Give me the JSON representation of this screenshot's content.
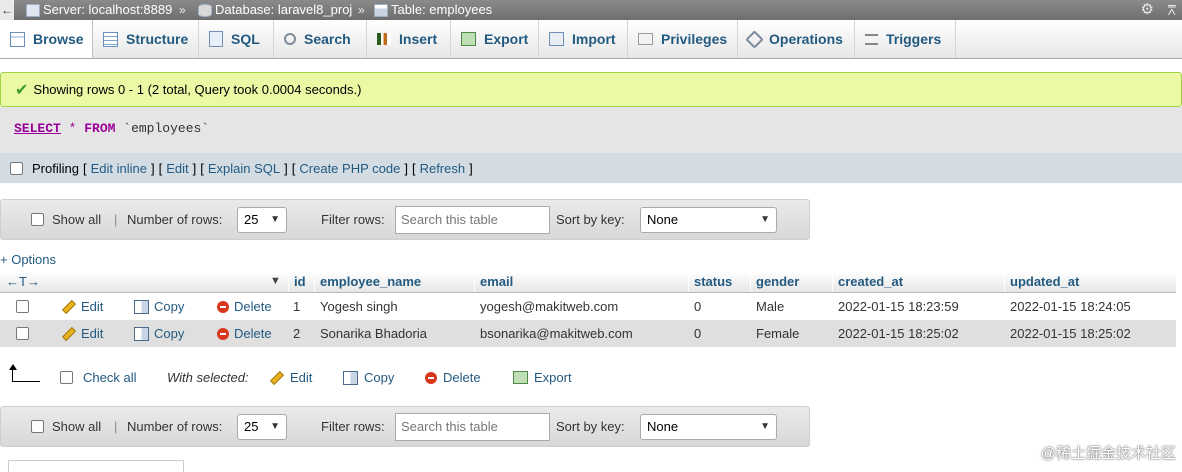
{
  "breadcrumb": {
    "back": "←",
    "server": "Server: localhost:8889",
    "database": "Database: laravel8_proj",
    "table": "Table: employees",
    "separator": "»"
  },
  "tabs": [
    {
      "label": "Browse",
      "icon": "browse-icon",
      "active": true
    },
    {
      "label": "Structure",
      "icon": "structure-icon"
    },
    {
      "label": "SQL",
      "icon": "sql-icon"
    },
    {
      "label": "Search",
      "icon": "search-icon"
    },
    {
      "label": "Insert",
      "icon": "insert-icon"
    },
    {
      "label": "Export",
      "icon": "export-icon"
    },
    {
      "label": "Import",
      "icon": "import-icon"
    },
    {
      "label": "Privileges",
      "icon": "privileges-icon"
    },
    {
      "label": "Operations",
      "icon": "operations-icon"
    },
    {
      "label": "Triggers",
      "icon": "triggers-icon"
    }
  ],
  "message": {
    "text": "Showing rows 0 - 1 (2 total, Query took 0.0004 seconds.)"
  },
  "sql": {
    "select": "SELECT",
    "star": "*",
    "from": "FROM",
    "table": "`employees`"
  },
  "profiling": {
    "label": "Profiling",
    "open": "[",
    "close": "]",
    "links": [
      "Edit inline",
      "Edit",
      "Explain SQL",
      "Create PHP code",
      "Refresh"
    ]
  },
  "nav": {
    "show_all": "Show all",
    "divider": "|",
    "rows_label": "Number of rows:",
    "rows_value": "25",
    "filter_label": "Filter rows:",
    "filter_placeholder": "Search this table",
    "sort_label": "Sort by key:",
    "sort_value": "None"
  },
  "options_link": "+ Options",
  "table": {
    "arrows": "←T→",
    "columns": [
      "id",
      "employee_name",
      "email",
      "status",
      "gender",
      "created_at",
      "updated_at"
    ],
    "action_labels": {
      "edit": "Edit",
      "copy": "Copy",
      "delete": "Delete"
    },
    "rows": [
      {
        "id": "1",
        "employee_name": "Yogesh singh",
        "email": "yogesh@makitweb.com",
        "status": "0",
        "gender": "Male",
        "created_at": "2022-01-15 18:23:59",
        "updated_at": "2022-01-15 18:24:05"
      },
      {
        "id": "2",
        "employee_name": "Sonarika Bhadoria",
        "email": "bsonarika@makitweb.com",
        "status": "0",
        "gender": "Female",
        "created_at": "2022-01-15 18:25:02",
        "updated_at": "2022-01-15 18:25:02"
      }
    ]
  },
  "with_selected": {
    "check_all": "Check all",
    "label": "With selected:",
    "edit": "Edit",
    "copy": "Copy",
    "delete": "Delete",
    "export": "Export"
  },
  "watermark": "@稀土掘金技术社区",
  "colors": {
    "link": "#235a81",
    "success_bg": "#ebf8a4",
    "success_border": "#a2d246",
    "keyword": "#990099"
  }
}
